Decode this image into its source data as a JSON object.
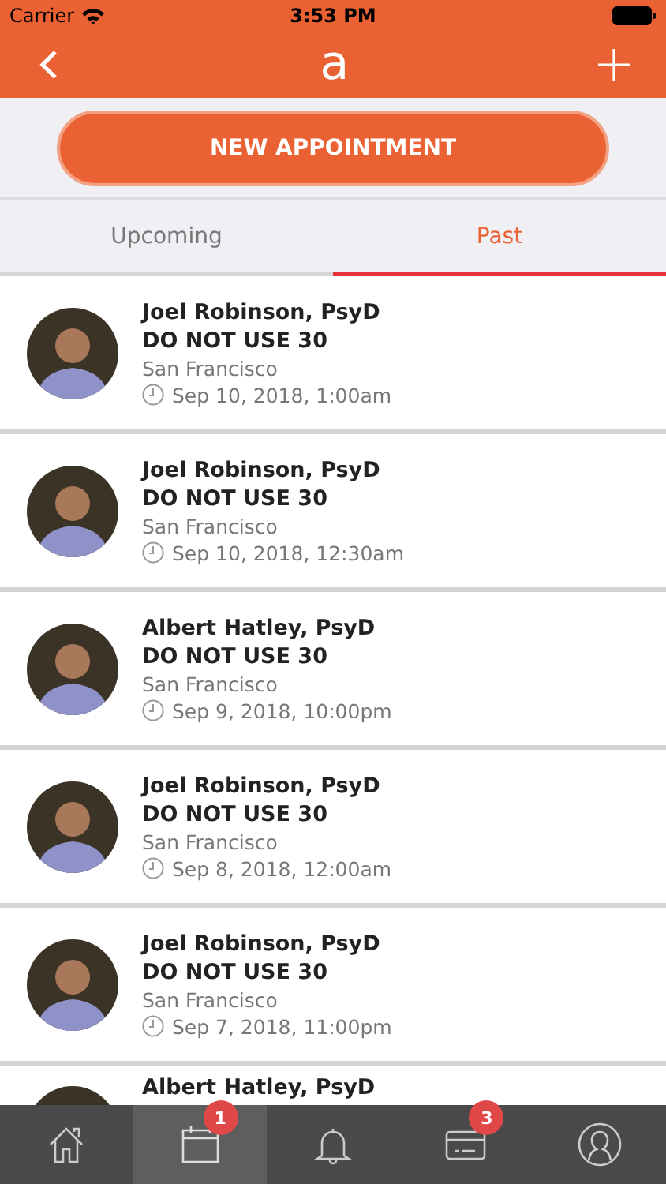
{
  "status_bar": {
    "carrier": "Carrier",
    "time": "3:53 PM"
  },
  "nav_bar": {
    "logo": "a"
  },
  "new_button": {
    "label": "NEW APPOINTMENT"
  },
  "tabs": [
    {
      "label": "Upcoming",
      "selected": false
    },
    {
      "label": "Past",
      "selected": true
    }
  ],
  "appointments": [
    {
      "provider": "Joel Robinson, PsyD",
      "title": "DO NOT USE 30",
      "location": "San Francisco",
      "time": "Sep 10, 2018, 1:00am"
    },
    {
      "provider": "Joel Robinson, PsyD",
      "title": "DO NOT USE 30",
      "location": "San Francisco",
      "time": "Sep 10, 2018, 12:30am"
    },
    {
      "provider": "Albert Hatley, PsyD",
      "title": "DO NOT USE 30",
      "location": "San Francisco",
      "time": "Sep 9, 2018, 10:00pm"
    },
    {
      "provider": "Joel Robinson, PsyD",
      "title": "DO NOT USE 30",
      "location": "San Francisco",
      "time": "Sep 8, 2018, 12:00am"
    },
    {
      "provider": "Joel Robinson, PsyD",
      "title": "DO NOT USE 30",
      "location": "San Francisco",
      "time": "Sep 7, 2018, 11:00pm"
    },
    {
      "provider": "Albert Hatley, PsyD"
    }
  ],
  "tab_bar": [
    {
      "kind": "home",
      "selected": false
    },
    {
      "kind": "calendar",
      "selected": true,
      "badge": "1"
    },
    {
      "kind": "bell",
      "selected": false
    },
    {
      "kind": "card",
      "selected": false,
      "badge": "3"
    },
    {
      "kind": "profile",
      "selected": false
    }
  ]
}
